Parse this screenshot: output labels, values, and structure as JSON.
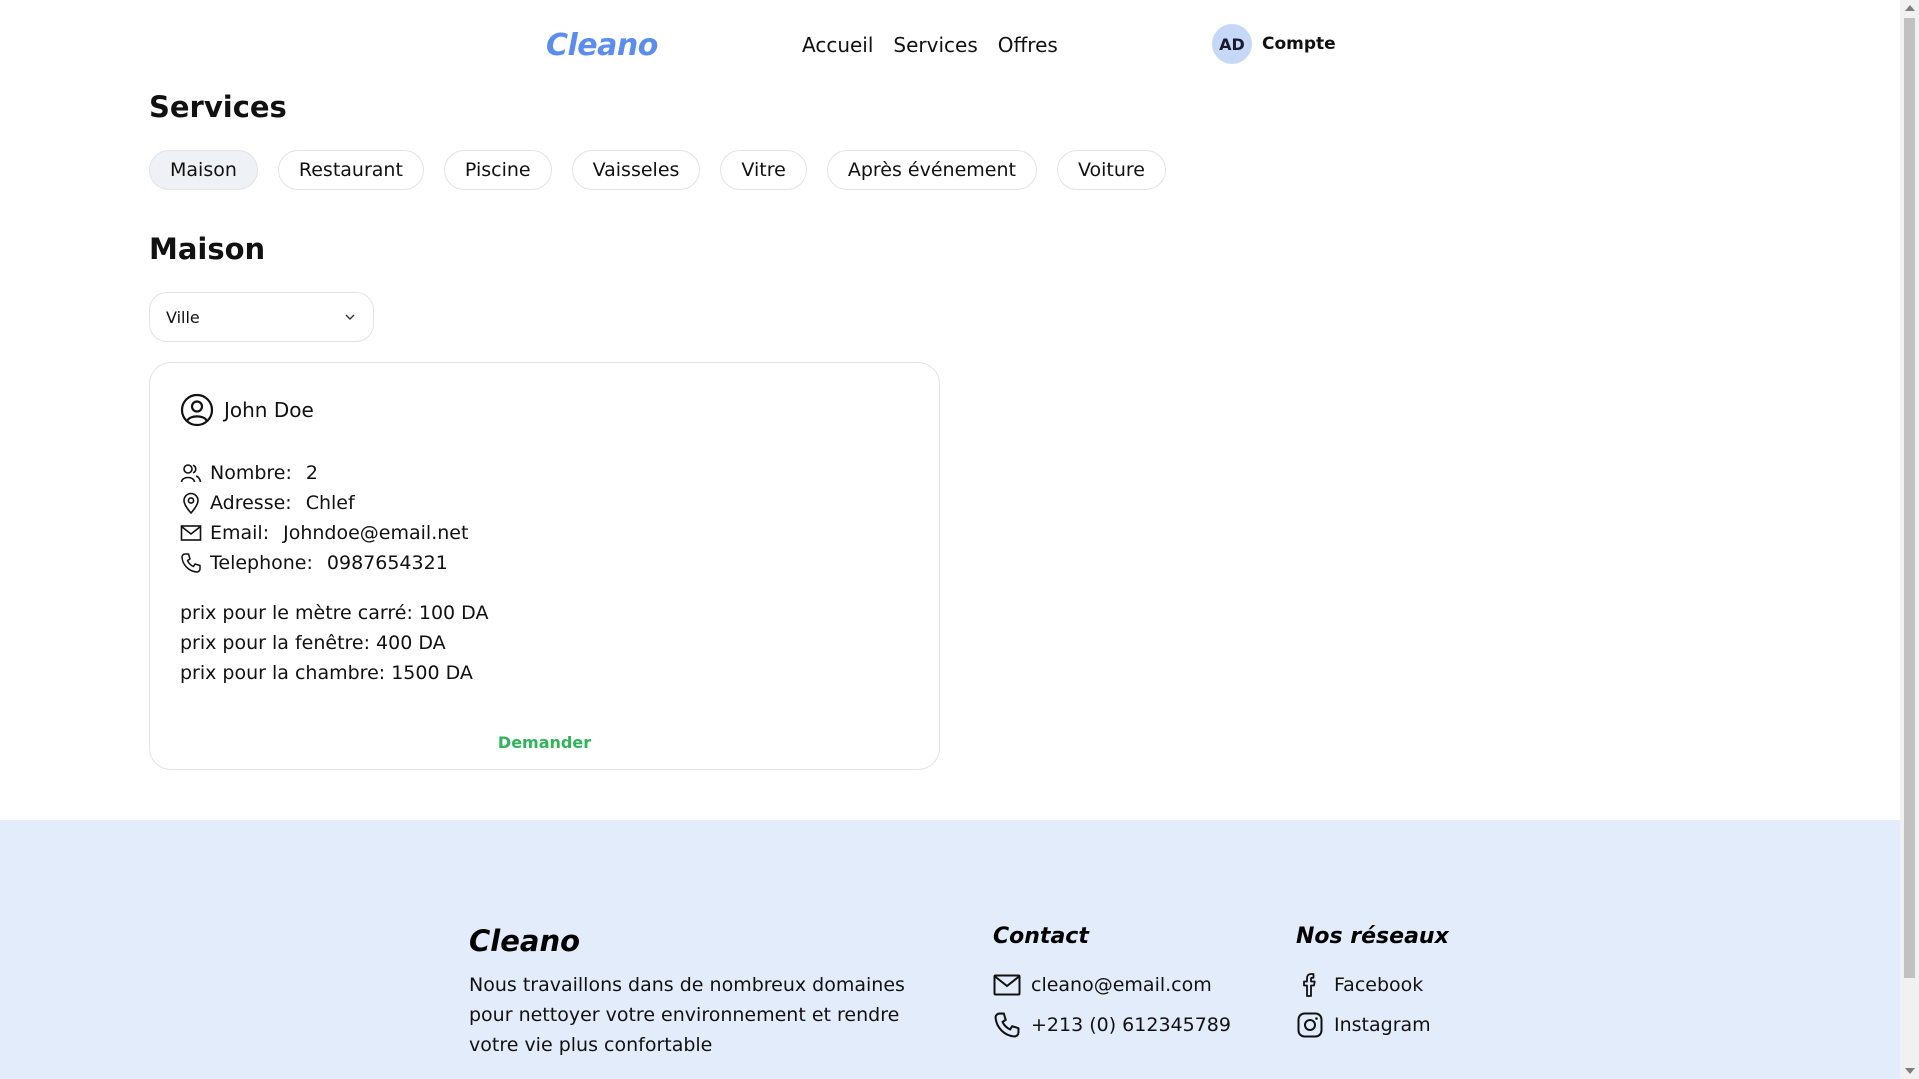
{
  "header": {
    "logo": "Cleano",
    "nav": [
      "Accueil",
      "Services",
      "Offres"
    ],
    "avatar_initials": "AD",
    "account_label": "Compte"
  },
  "services": {
    "title": "Services",
    "tabs": [
      "Maison",
      "Restaurant",
      "Piscine",
      "Vaisseles",
      "Vitre",
      "Après événement",
      "Voiture"
    ],
    "active_tab": "Maison"
  },
  "section": {
    "title": "Maison",
    "city_select": {
      "selected": "Ville"
    }
  },
  "card": {
    "name": "John Doe",
    "nombre_label": "Nombre:",
    "nombre_value": "2",
    "adresse_label": "Adresse:",
    "adresse_value": "Chlef",
    "email_label": "Email:",
    "email_value": "Johndoe@email.net",
    "telephone_label": "Telephone:",
    "telephone_value": "0987654321",
    "prices": [
      "prix pour le mètre carré: 100 DA",
      "prix pour la fenêtre: 400 DA",
      "prix pour la chambre: 1500 DA"
    ],
    "action_label": "Demander"
  },
  "footer": {
    "logo": "Cleano",
    "description": "Nous travaillons dans de nombreux domaines pour nettoyer votre environnement et rendre votre vie plus confortable",
    "contact_title": "Contact",
    "contact_email": "cleano@email.com",
    "contact_phone": "+213 (0) 612345789",
    "social_title": "Nos réseaux",
    "facebook": "Facebook",
    "instagram": "Instagram"
  },
  "colors": {
    "brand": "#5b8def",
    "action": "#2fb45a",
    "footer_bg": "#e3ecfb",
    "avatar_bg": "#c6d8f7"
  }
}
